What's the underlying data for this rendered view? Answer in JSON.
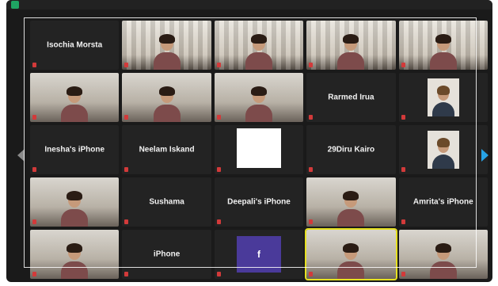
{
  "meeting": {
    "topbar_items": [
      "",
      "",
      ""
    ],
    "shield_color": "#1fa463"
  },
  "tiles": [
    {
      "name": "Isochia Morsta",
      "kind": "name"
    },
    {
      "name": "",
      "kind": "video-shelf"
    },
    {
      "name": "",
      "kind": "video-shelf"
    },
    {
      "name": "",
      "kind": "video-shelf"
    },
    {
      "name": "",
      "kind": "video-shelf"
    },
    {
      "name": "",
      "kind": "video"
    },
    {
      "name": "",
      "kind": "video"
    },
    {
      "name": "",
      "kind": "video"
    },
    {
      "name": "Rarmed Irua",
      "kind": "name"
    },
    {
      "name": "",
      "kind": "portrait"
    },
    {
      "name": "Inesha's iPhone",
      "kind": "name"
    },
    {
      "name": "Neelam Iskand",
      "kind": "name"
    },
    {
      "name": "",
      "kind": "blank"
    },
    {
      "name": "29Diru Kairo",
      "kind": "name"
    },
    {
      "name": "",
      "kind": "portrait"
    },
    {
      "name": "",
      "kind": "video"
    },
    {
      "name": "Sushama",
      "kind": "name"
    },
    {
      "name": "Deepali's iPhone",
      "kind": "name"
    },
    {
      "name": "",
      "kind": "video"
    },
    {
      "name": "Amrita's iPhone",
      "kind": "name"
    },
    {
      "name": "",
      "kind": "video"
    },
    {
      "name": "iPhone",
      "kind": "name"
    },
    {
      "name": "f",
      "kind": "fb"
    },
    {
      "name": "",
      "kind": "video-active"
    },
    {
      "name": "",
      "kind": "video"
    }
  ]
}
